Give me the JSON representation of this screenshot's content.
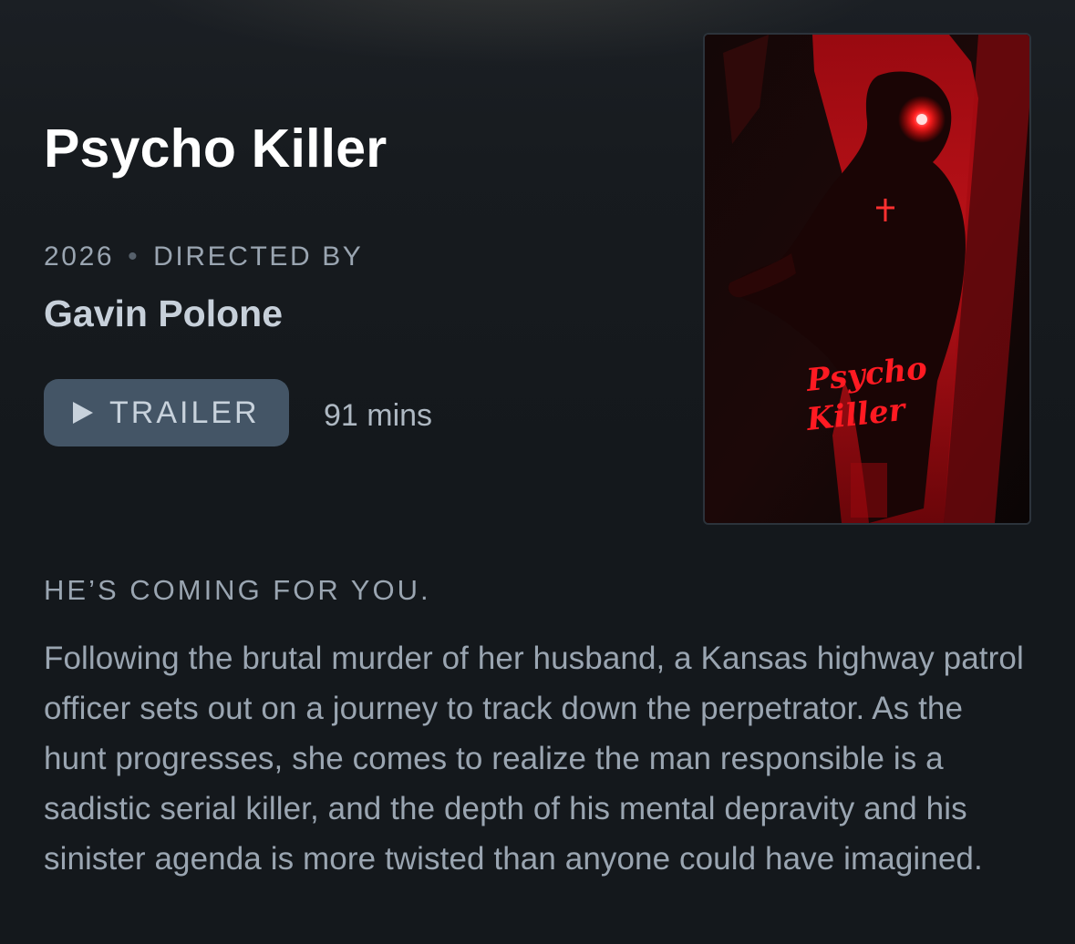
{
  "film": {
    "title": "Psycho Killer",
    "year": "2026",
    "directed_by_label": "DIRECTED BY",
    "director": "Gavin Polone",
    "runtime": "91 mins",
    "tagline": "HE’S COMING FOR YOU.",
    "synopsis": "Following the brutal murder of her husband, a Kansas highway patrol officer sets out on a journey to track down the perpetrator. As the hunt progresses, she comes to realize the man responsible is a sadistic serial killer, and the depth of his mental depravity and his sinister agenda is more twisted than anyone could have imagined."
  },
  "actions": {
    "trailer_label": "TRAILER",
    "trailer_icon": "play-icon"
  },
  "poster": {
    "title_line1": "Psycho",
    "title_line2": "Killer",
    "accent_color": "#e0141c"
  },
  "colors": {
    "background": "#14181c",
    "title": "#ffffff",
    "muted_text": "#9aa5b1",
    "button_bg": "#445566"
  }
}
